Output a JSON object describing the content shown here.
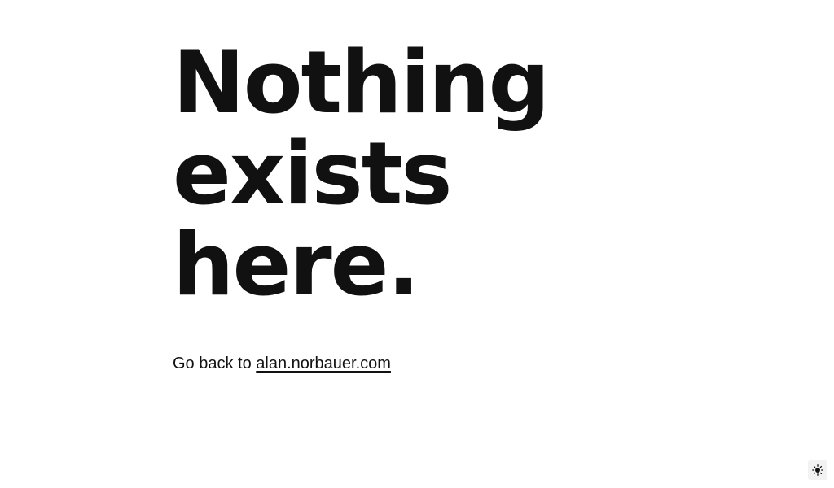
{
  "headline": {
    "line1": "Nothing",
    "line2": "exists",
    "line3": "here."
  },
  "back": {
    "prefix": "Go back to ",
    "link_text": "alan.norbauer.com"
  },
  "theme_toggle": {
    "icon": "sun-icon"
  },
  "colors": {
    "text": "#111111",
    "background": "#ffffff"
  }
}
